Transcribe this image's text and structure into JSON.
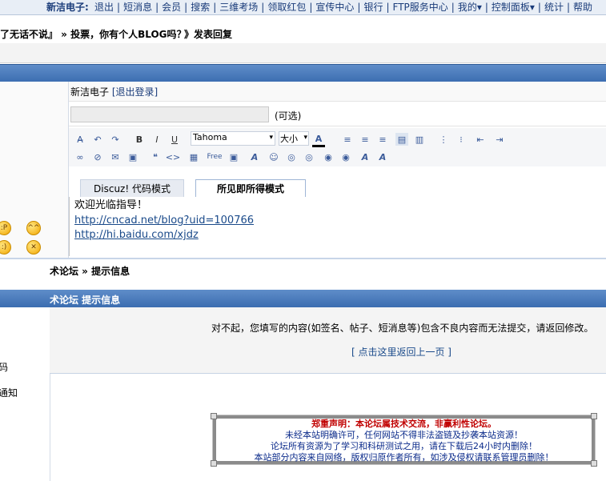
{
  "topnav": {
    "brand": "新洁电子:",
    "items": [
      "退出",
      "短消息",
      "会员",
      "搜索",
      "三维考场",
      "领取红包",
      "宣传中心",
      "银行",
      "FTP服务中心",
      "我的▾",
      "控制面板▾",
      "统计",
      "帮助"
    ]
  },
  "breadcrumb": "》发表回复",
  "breadcrumb_prefix": "了无话不说』 » 投票，你有个人BLOG吗？",
  "user": {
    "name": "新洁电子",
    "logout": "[退出登录]"
  },
  "subject": {
    "value": "",
    "optional_label": "(可选)"
  },
  "toolbar": {
    "font": "Tahoma",
    "size": "大小"
  },
  "tabs": {
    "code": "Discuz! 代码模式",
    "wysiwyg": "所见即所得模式"
  },
  "editor": {
    "line1": "欢迎光临指导！",
    "link1": "http://cncad.net/blog?uid=100766",
    "link2": "http://hi.baidu.com/xjdz"
  },
  "crumb2": "术论坛 » 提示信息",
  "bluebar2": "术论坛 提示信息",
  "leftcol2": {
    "item1": "码",
    "item2": "通知"
  },
  "message": {
    "text": "对不起，您填写的内容(如签名、帖子、短消息等)包含不良内容而无法提交，请返回修改。",
    "back": "[ 点击这里返回上一页 ]"
  },
  "notice": {
    "title": "郑重声明：本论坛属技术交流，非赢利性论坛。",
    "lines": [
      "未经本站明确许可，任何网站不得非法盗链及抄袭本站资源！",
      "论坛所有资源为了学习和科研测试之用，请在下载后24小时内删除！",
      "本站部分内容来自网络，版权归原作者所有，如涉及侵权请联系管理员删除！"
    ]
  },
  "colors": {
    "blue_bar": "#3b6db0",
    "link": "#1a4a8a",
    "notice_title": "#c00000"
  }
}
